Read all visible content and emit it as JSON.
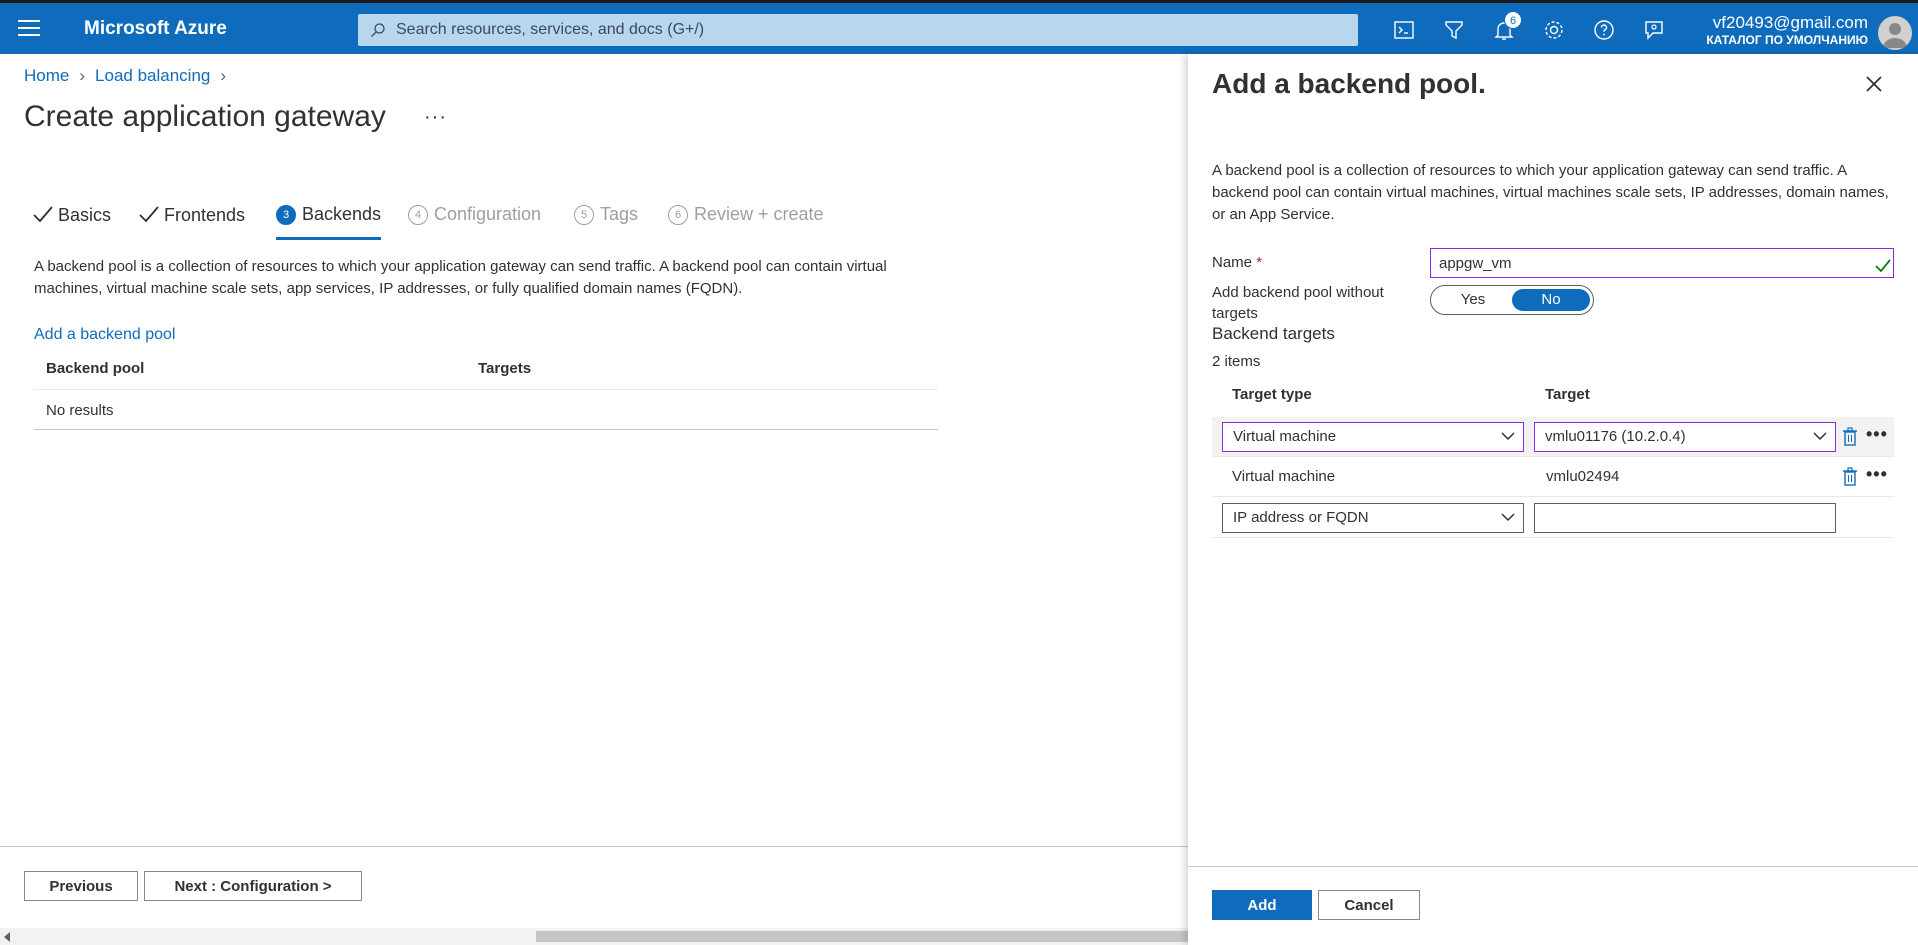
{
  "topbar": {
    "brand": "Microsoft Azure",
    "search_placeholder": "Search resources, services, and docs (G+/)",
    "notification_count": "6",
    "account_email": "vf20493@gmail.com",
    "account_directory": "КАТАЛОГ ПО УМОЛЧАНИЮ",
    "accent_color": "#0f6cbd"
  },
  "breadcrumb": {
    "home": "Home",
    "load_balancing": "Load balancing"
  },
  "page": {
    "title": "Create application gateway",
    "more": "···"
  },
  "steps": [
    {
      "num": "",
      "label": "Basics",
      "state": "done"
    },
    {
      "num": "",
      "label": "Frontends",
      "state": "done"
    },
    {
      "num": "3",
      "label": "Backends",
      "state": "active"
    },
    {
      "num": "4",
      "label": "Configuration",
      "state": "todo"
    },
    {
      "num": "5",
      "label": "Tags",
      "state": "todo"
    },
    {
      "num": "6",
      "label": "Review + create",
      "state": "todo"
    }
  ],
  "backends": {
    "description": "A backend pool is a collection of resources to which your application gateway can send traffic. A backend pool can contain virtual machines, virtual machine scale sets, app services, IP addresses, or fully qualified domain names (FQDN).",
    "add_link": "Add a backend pool",
    "columns": [
      "Backend pool",
      "Targets"
    ],
    "empty": "No results"
  },
  "footer": {
    "previous": "Previous",
    "next": "Next : Configuration >"
  },
  "panel": {
    "title": "Add a backend pool.",
    "description": "A backend pool is a collection of resources to which your application gateway can send traffic. A backend pool can contain virtual machines, virtual machines scale sets, IP addresses, domain names, or an App Service.",
    "name_label": "Name",
    "name_required": "*",
    "name_value": "appgw_vm",
    "without_targets_label": "Add backend pool without targets",
    "toggle_yes": "Yes",
    "toggle_no": "No",
    "section": "Backend targets",
    "count": "2 items",
    "columns": [
      "Target type",
      "Target"
    ],
    "rows": [
      {
        "type": "Virtual machine",
        "target": "vmlu01176 (10.2.0.4)"
      },
      {
        "type": "Virtual machine",
        "target": "vmlu02494"
      },
      {
        "type": "IP address or FQDN",
        "target": ""
      }
    ],
    "add": "Add",
    "cancel": "Cancel"
  }
}
